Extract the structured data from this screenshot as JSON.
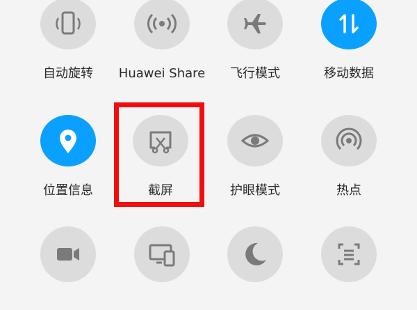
{
  "tiles": [
    {
      "label": "自动旋转",
      "icon": "auto-rotate-icon",
      "active": false
    },
    {
      "label": "Huawei Share",
      "icon": "huawei-share-icon",
      "active": false
    },
    {
      "label": "飞行模式",
      "icon": "airplane-icon",
      "active": false
    },
    {
      "label": "移动数据",
      "icon": "mobile-data-icon",
      "active": true
    },
    {
      "label": "位置信息",
      "icon": "location-icon",
      "active": true
    },
    {
      "label": "截屏",
      "icon": "screenshot-icon",
      "active": false
    },
    {
      "label": "护眼模式",
      "icon": "eye-icon",
      "active": false
    },
    {
      "label": "热点",
      "icon": "hotspot-icon",
      "active": false
    },
    {
      "label": "",
      "icon": "screen-record-icon",
      "active": false
    },
    {
      "label": "",
      "icon": "multi-screen-icon",
      "active": false
    },
    {
      "label": "",
      "icon": "dark-mode-icon",
      "active": false
    },
    {
      "label": "",
      "icon": "scroll-screenshot-icon",
      "active": false
    }
  ],
  "colors": {
    "accent": "#0aa0ff",
    "highlight": "#f20d0d",
    "tile": "#dcdcdc",
    "icon": "#7a7a7a"
  }
}
